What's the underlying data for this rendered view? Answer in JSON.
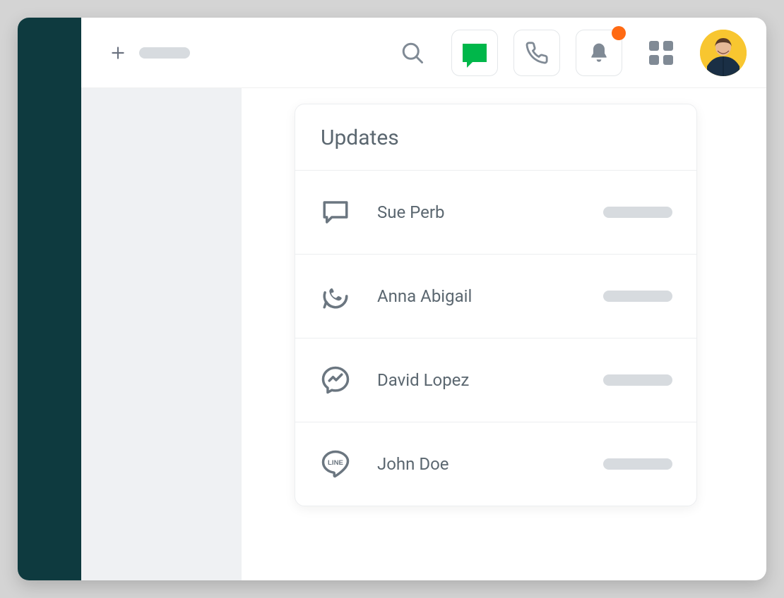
{
  "colors": {
    "accent": "#00b74a",
    "badge": "#ff6a13",
    "sidebar": "#0e3a3f"
  },
  "topbar": {
    "add_label": "+",
    "search_icon": "search-icon",
    "chat_icon": "chat-icon",
    "phone_icon": "phone-icon",
    "bell_icon": "bell-icon",
    "grid_icon": "apps-icon",
    "notification_badge": true
  },
  "updates_panel": {
    "title": "Updates",
    "items": [
      {
        "name": "Sue Perb",
        "channel_icon": "message-icon"
      },
      {
        "name": "Anna Abigail",
        "channel_icon": "whatsapp-icon"
      },
      {
        "name": "David Lopez",
        "channel_icon": "messenger-icon"
      },
      {
        "name": "John Doe",
        "channel_icon": "line-icon"
      }
    ]
  }
}
